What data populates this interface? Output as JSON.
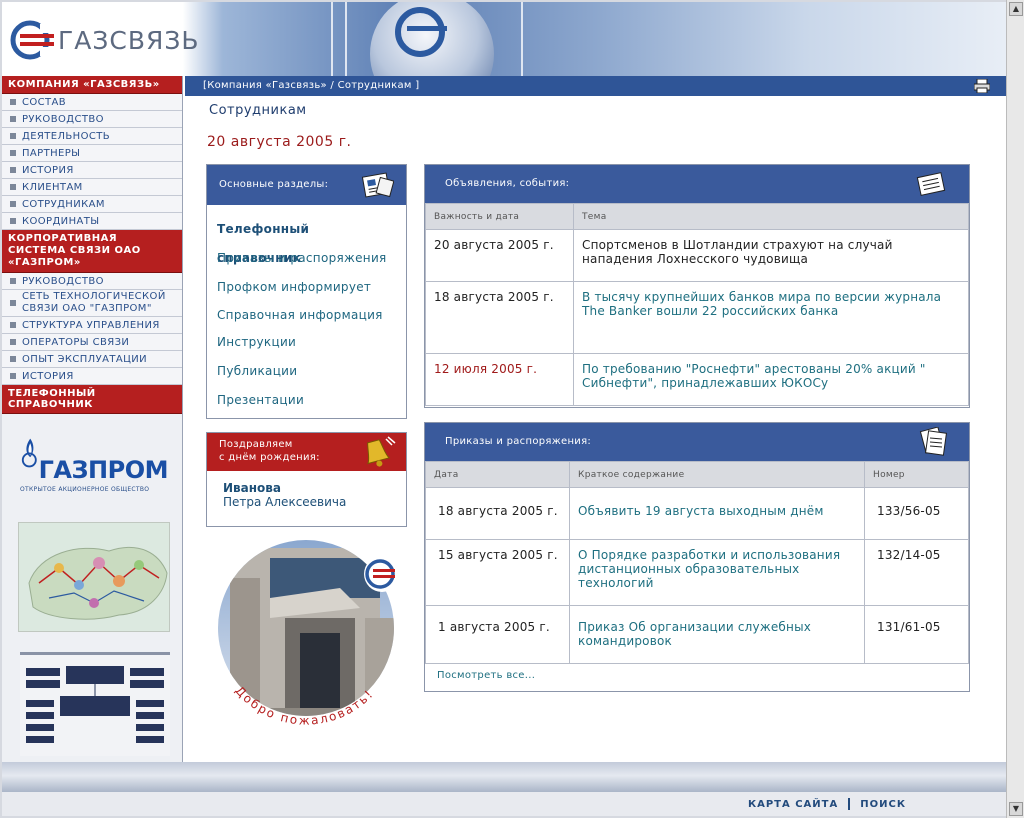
{
  "header": {
    "logo_text": "ГАЗСВЯЗЬ"
  },
  "breadcrumb": "[Компания «Газсвязь» / Сотрудникам ]",
  "leftnav": {
    "section1_title": "КОМПАНИЯ «ГАЗСВЯЗЬ»",
    "section1_items": [
      "СОСТАВ",
      "РУКОВОДСТВО",
      "ДЕЯТЕЛЬНОСТЬ",
      "ПАРТНЕРЫ",
      "ИСТОРИЯ",
      "КЛИЕНТАМ",
      "СОТРУДНИКАМ",
      "КООРДИНАТЫ"
    ],
    "section2_title": "КОРПОРАТИВНАЯ СИСТЕМА СВЯЗИ ОАО «ГАЗПРОМ»",
    "section2_items": [
      "РУКОВОДСТВО",
      "СЕТЬ ТЕХНОЛОГИЧЕСКОЙ СВЯЗИ ОАО \"ГАЗПРОМ\"",
      "СТРУКТУРА УПРАВЛЕНИЯ",
      "ОПЕРАТОРЫ СВЯЗИ",
      "ОПЫТ ЭКСПЛУАТАЦИИ",
      "ИСТОРИЯ"
    ],
    "section3_title": "ТЕЛЕФОННЫЙ СПРАВОЧНИК",
    "gazprom_word": "ГАЗПРОМ",
    "gazprom_sub": "ОТКРЫТОЕ АКЦИОНЕРНОЕ ОБЩЕСТВО"
  },
  "main": {
    "section_title": "Сотрудникам",
    "date": "20 августа 2005 г."
  },
  "sections_box": {
    "title": "Основные разделы:",
    "links": [
      "Телефонный справочник",
      "Приказы и распоряжения",
      "Профком информирует",
      "Справочная информация",
      "Инструкции",
      "Публикации",
      "Презентации"
    ]
  },
  "birthday_box": {
    "title_line1": "Поздравляем",
    "title_line2": "с днём рождения:",
    "name_line1": "Иванова",
    "name_line2": "Петра Алексеевича"
  },
  "welcome": "Добро пожаловать!",
  "news": {
    "title": "Объявления, события:",
    "col_date": "Важность и дата",
    "col_topic": "Тема",
    "rows": [
      {
        "date": "20 августа 2005 г.",
        "topic": "Спортсменов в Шотландии страхуют на случай нападения Лохнесского чудовища"
      },
      {
        "date": "18 августа 2005 г.",
        "topic": "В тысячу крупнейших банков мира по версии журнала The Banker вошли 22 российских банка"
      },
      {
        "date": "12 июля 2005 г.",
        "topic": "По требованию \"Роснефти\" арестованы 20% акций \" Сибнефти\", принадлежавших ЮКОСу"
      }
    ]
  },
  "orders": {
    "title": "Приказы и распоряжения:",
    "col_date": "Дата",
    "col_summary": "Краткое содержание",
    "col_number": "Номер",
    "rows": [
      {
        "date": "18 августа 2005 г.",
        "summary": "Объявить 19 августа выходным днём",
        "number": "133/56-05"
      },
      {
        "date": "15 августа 2005 г.",
        "summary": "О Порядке разработки и использования дистанционных образовательных технологий",
        "number": "132/14-05"
      },
      {
        "date": "1 августа 2005 г.",
        "summary": "Приказ Об организации служебных командировок",
        "number": "131/61-05"
      }
    ],
    "view_all": "Посмотреть все..."
  },
  "footer": {
    "sitemap": "КАРТА САЙТА",
    "search": "ПОИСК"
  },
  "colors": {
    "brand_blue": "#2f5597",
    "brand_red": "#b51f1f",
    "link": "#1e6f80"
  }
}
